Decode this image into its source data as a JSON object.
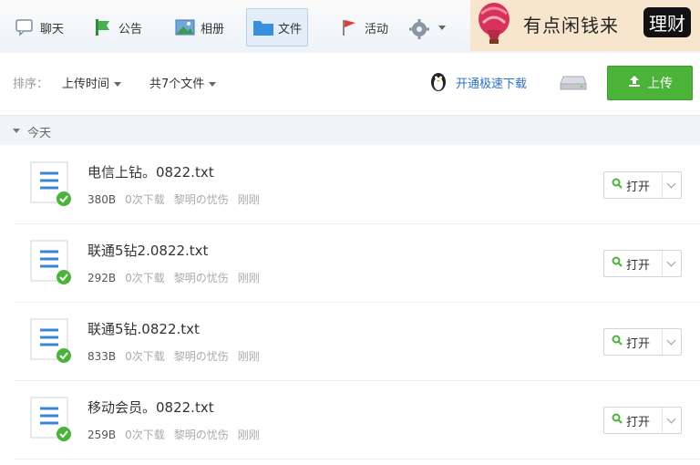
{
  "nav": {
    "tabs": [
      {
        "label": "聊天",
        "icon": "chat-bubble-icon"
      },
      {
        "label": "公告",
        "icon": "announcement-icon"
      },
      {
        "label": "相册",
        "icon": "photo-album-icon"
      },
      {
        "label": "文件",
        "icon": "folder-icon",
        "active": true
      },
      {
        "label": "活动",
        "icon": "flag-icon"
      }
    ],
    "settings_icon": "gear-icon"
  },
  "ad": {
    "text": "有点闲钱来",
    "badge": "理财",
    "icon": "hot-air-balloon-icon"
  },
  "toolbar": {
    "sort_prefix": "排序：",
    "sort_value": "上传时间",
    "count_label": "共7个文件",
    "speed_link": "开通极速下载",
    "upload_label": "上传",
    "accent": "#4ab338"
  },
  "group": {
    "label": "今天"
  },
  "files": [
    {
      "name": "电信上钻。0822.txt",
      "size": "380B",
      "downloads": "0次下载",
      "uploader": "黎明の忧伤",
      "time": "刚刚",
      "open_label": "打开"
    },
    {
      "name": "联通5钻2.0822.txt",
      "size": "292B",
      "downloads": "0次下载",
      "uploader": "黎明の忧伤",
      "time": "刚刚",
      "open_label": "打开"
    },
    {
      "name": "联通5钻.0822.txt",
      "size": "833B",
      "downloads": "0次下载",
      "uploader": "黎明の忧伤",
      "time": "刚刚",
      "open_label": "打开"
    },
    {
      "name": "移动会员。0822.txt",
      "size": "259B",
      "downloads": "0次下载",
      "uploader": "黎明の忧伤",
      "time": "刚刚",
      "open_label": "打开"
    }
  ]
}
